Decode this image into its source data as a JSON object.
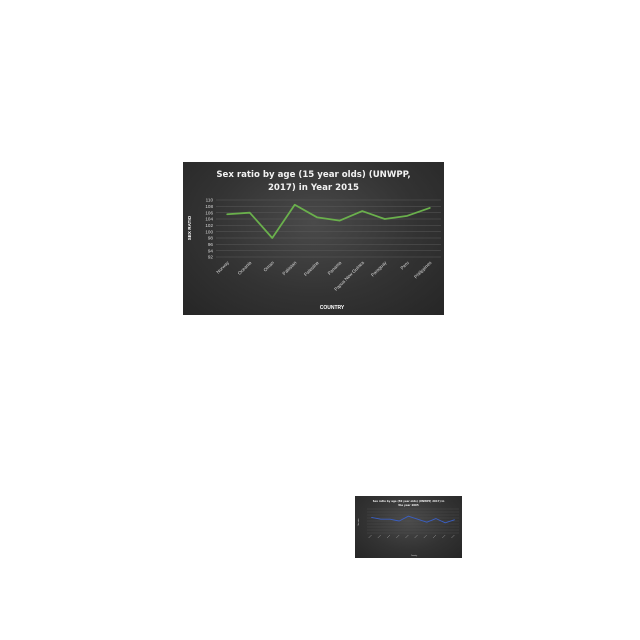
{
  "chart_data": [
    {
      "type": "line",
      "title_lines": [
        "Sex ratio by age (15 year olds) (UNWPP,",
        "2017) in Year 2015"
      ],
      "xlabel": "COUNTRY",
      "ylabel": "SEX RATIO",
      "categories": [
        "Norway",
        "Oceania",
        "Oman",
        "Pakistan",
        "Palestine",
        "Panama",
        "Papua New Guinea",
        "Paraguay",
        "Peru",
        "Philippines"
      ],
      "series": [
        {
          "values": [
            105.5,
            106,
            98,
            108.5,
            104.5,
            103.5,
            106.5,
            104,
            105,
            107.5
          ],
          "color": "#6ab04c"
        }
      ],
      "ylim": [
        92,
        110
      ],
      "yticks": [
        92,
        94,
        96,
        98,
        100,
        102,
        104,
        106,
        108,
        110
      ],
      "grid": true
    },
    {
      "type": "line",
      "title_lines": [
        "Sex ratio by age (50 year olds) (UNWPP, 2017) in",
        "the year 2005"
      ],
      "xlabel": "Country",
      "ylabel": "Sex ratio",
      "series": [
        {
          "values": [
            106,
            103,
            103,
            100,
            108,
            103,
            98,
            104,
            97,
            102
          ],
          "color": "#3a5fc4"
        }
      ],
      "ylim": [
        80,
        120
      ],
      "grid": true
    }
  ]
}
